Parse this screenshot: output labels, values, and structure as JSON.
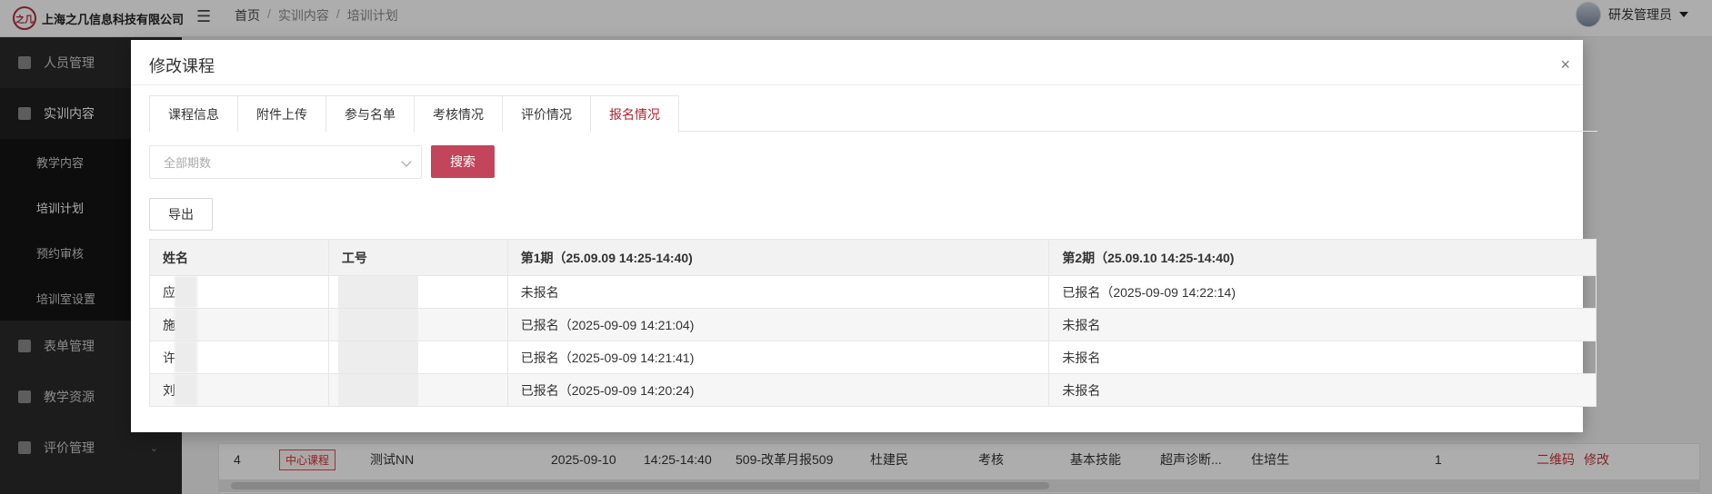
{
  "header": {
    "company": "上海之几信息科技有限公司",
    "logo_glyph": "之几",
    "breadcrumb": [
      "首页",
      "实训内容",
      "培训计划"
    ],
    "user": "研发管理员"
  },
  "sidebar": {
    "items": [
      {
        "label": "人员管理"
      },
      {
        "label": "实训内容"
      },
      {
        "label": "表单管理"
      },
      {
        "label": "教学资源"
      },
      {
        "label": "评价管理"
      }
    ],
    "subitems": [
      "教学内容",
      "培训计划",
      "预约审核",
      "培训室设置"
    ]
  },
  "background_row": {
    "index": "4",
    "tag": "中心课程",
    "name": "测试NN",
    "date": "2025-09-10",
    "time": "14:25-14:40",
    "room": "509-改革月报509",
    "teacher": "杜建民",
    "type": "考核",
    "skill": "基本技能",
    "category": "超声诊断...",
    "target": "住培生",
    "count": "1",
    "action_qr": "二维码",
    "action_edit": "修改"
  },
  "modal": {
    "title": "修改课程",
    "close": "×",
    "tabs": [
      "课程信息",
      "附件上传",
      "参与名单",
      "考核情况",
      "评价情况",
      "报名情况"
    ],
    "active_tab": 5,
    "filter_placeholder": "全部期数",
    "search_label": "搜索",
    "export_label": "导出",
    "table": {
      "columns": [
        "姓名",
        "工号",
        "第1期（25.09.09 14:25-14:40)",
        "第2期（25.09.10 14:25-14:40)"
      ],
      "rows": [
        {
          "name": "应",
          "id": "",
          "p1": "未报名",
          "p2": "已报名（2025-09-09 14:22:14)"
        },
        {
          "name": "施",
          "id": "",
          "p1": "已报名（2025-09-09 14:21:04)",
          "p2": "未报名"
        },
        {
          "name": "许",
          "id": "",
          "p1": "已报名（2025-09-09 14:21:41)",
          "p2": "未报名"
        },
        {
          "name": "刘",
          "id": "",
          "p1": "已报名（2025-09-09 14:20:24)",
          "p2": "未报名"
        }
      ]
    }
  },
  "colors": {
    "accent": "#c2455b",
    "active_tab": "#b02030",
    "sidebar_bg": "#2a2a2a"
  }
}
